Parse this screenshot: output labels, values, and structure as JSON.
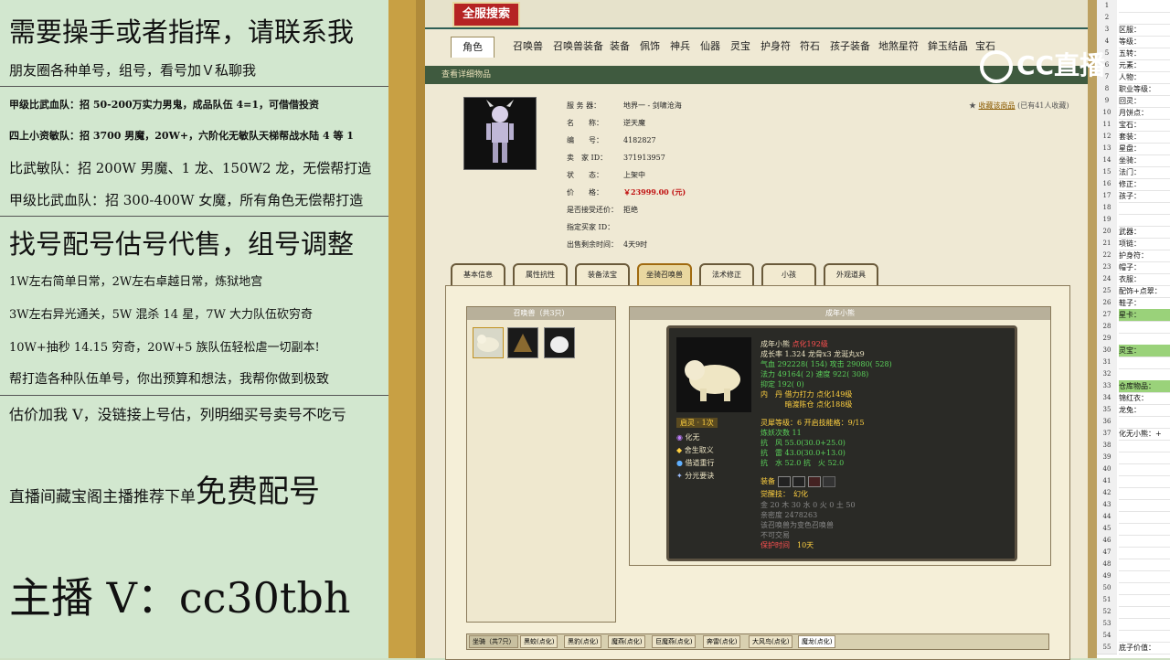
{
  "promo": {
    "line1": "需要操手或者指挥，请联系我",
    "line2": "朋友圈各种单号，组号，看号加Ｖ私聊我",
    "line3": "甲级比武血队：招 50-200万实力男鬼，成品队伍 4=1，可借借投资",
    "line4": "四上小资敏队：招 3700 男魔，20W+，六阶化无敏队天梯帮战水陆 4 等 1",
    "line5": "比武敏队：招 200W 男魔、1 龙、150W2 龙，无偿帮打造",
    "line6": "甲级比武血队：招 300-400W 女魔，所有角色无偿帮打造",
    "line7": "找号配号估号代售，组号调整",
    "line8": "1W左右简单日常，2W左右卓越日常，炼狱地宫",
    "line9": "3W左右异光通关，5W 混杀 14 星，7W 大力队伍砍穷奇",
    "line10": "10W+抽秒 14.15 穷奇，20W+5 族队伍轻松虐一切副本!",
    "line11": "帮打造各种队伍单号，你出预算和想法，我帮你做到极致",
    "line12": "估价加我 V，没链接上号估，列明细买号卖号不吃亏",
    "line13a": "直播间藏宝阁主播推荐下单",
    "line13b": "免费配号",
    "line14": "主播 V：cc30tbh"
  },
  "game": {
    "search_title": "全服搜索",
    "tabs": [
      "角色",
      "召唤兽",
      "召唤兽装备",
      "装备",
      "佩饰",
      "神兵",
      "仙器",
      "灵宝",
      "护身符",
      "符石",
      "孩子装备",
      "地煞星符",
      "鉾玉结晶",
      "宝石"
    ],
    "green_bar": "查看详细物品",
    "info": [
      {
        "k": "服 务 器：",
        "v": "地界一 - 剑啸沧海"
      },
      {
        "k": "名　　称：",
        "v": "逆天魔"
      },
      {
        "k": "编　　号：",
        "v": "4182827"
      },
      {
        "k": "卖　家 ID：",
        "v": "371913957"
      },
      {
        "k": "状　　态：",
        "v": "上架中"
      },
      {
        "k": "价　　格：",
        "v": "￥23999.00 (元)"
      },
      {
        "k": "是否接受还价：",
        "v": "拒绝"
      },
      {
        "k": "指定买家 ID：",
        "v": ""
      },
      {
        "k": "出售剩余时间：",
        "v": "4天9时"
      }
    ],
    "fav_link": "收藏该商品",
    "fav_count": "(已有41人收藏)",
    "subtabs": [
      "基本信息",
      "属性抗性",
      "装备法宝",
      "坐骑召唤兽",
      "法术修正",
      "小孩",
      "外观道具"
    ],
    "pet_list_title": "召唤兽（共3只）",
    "detail_title": "成年小熊",
    "card": {
      "name": "成年小熊",
      "level": "点化192级",
      "growth": "成长率 1.324  龙骨x3  龙涎丸x9",
      "hp": "气血 292228( 154)  攻击 29080( 528)",
      "mp": "法力 49164( 2)  速度 922( 308)",
      "def": "抑定 192( 0)",
      "inner1": "内　丹  借力打力 点化149级",
      "inner2": "　　　  暗渡陈仓 点化188级",
      "awaken": "启灵 · 1次",
      "skills": [
        "化无",
        "舍生取义",
        "借道重行",
        "分光要诀"
      ],
      "soul": "灵犀等级：6  开启技能格：9/15",
      "refine": "炼妖次数 11",
      "res1": "抗　风 55.0(30.0+25.0)",
      "res2": "抗　雷 43.0(30.0+13.0)",
      "res3": "抗　水 52.0  抗　火 52.0",
      "equip": "装备",
      "awaken_skill": "觉醒技：　幻化",
      "gold": "金 20 木 30 水 0 火 0 土 50",
      "exp": "亲密度 2478263",
      "note1": "该召唤兽为变色召唤兽",
      "note2": "不可交易",
      "protect": "保护时间",
      "protect_val": "10天"
    },
    "bottom_tabs": [
      "坐骑（共7只）",
      "黑蛟(点化)",
      "黑豹(点化)",
      "魔燕(点化)",
      "巨魔燕(点化)",
      "奔雷(点化)",
      "大风鸟(点化)",
      "魔龙(点化)"
    ]
  },
  "sheet": {
    "rows": [
      {
        "n": "1",
        "v": ""
      },
      {
        "n": "2",
        "v": ""
      },
      {
        "n": "3",
        "v": "区服："
      },
      {
        "n": "4",
        "v": "等级："
      },
      {
        "n": "5",
        "v": "五转："
      },
      {
        "n": "6",
        "v": "元素："
      },
      {
        "n": "7",
        "v": "人物："
      },
      {
        "n": "8",
        "v": "职业等级："
      },
      {
        "n": "9",
        "v": "回灵："
      },
      {
        "n": "10",
        "v": "月饼点："
      },
      {
        "n": "11",
        "v": "宝石："
      },
      {
        "n": "12",
        "v": "套装："
      },
      {
        "n": "13",
        "v": "星盘："
      },
      {
        "n": "14",
        "v": "坐骑："
      },
      {
        "n": "15",
        "v": "法门："
      },
      {
        "n": "16",
        "v": "修正："
      },
      {
        "n": "17",
        "v": "孩子："
      },
      {
        "n": "18",
        "v": ""
      },
      {
        "n": "19",
        "v": ""
      },
      {
        "n": "20",
        "v": "武器："
      },
      {
        "n": "21",
        "v": "项链："
      },
      {
        "n": "22",
        "v": "护身符："
      },
      {
        "n": "23",
        "v": "帽子："
      },
      {
        "n": "24",
        "v": "衣服："
      },
      {
        "n": "25",
        "v": "配饰+点翠："
      },
      {
        "n": "26",
        "v": "鞋子："
      },
      {
        "n": "27",
        "v": "星卡：",
        "hl": true
      },
      {
        "n": "28",
        "v": ""
      },
      {
        "n": "29",
        "v": ""
      },
      {
        "n": "30",
        "v": "灵宝：",
        "hl": true
      },
      {
        "n": "31",
        "v": ""
      },
      {
        "n": "32",
        "v": ""
      },
      {
        "n": "33",
        "v": "仓库物品：",
        "hl": true
      },
      {
        "n": "34",
        "v": "锦红衣："
      },
      {
        "n": "35",
        "v": "龙兔："
      },
      {
        "n": "36",
        "v": ""
      },
      {
        "n": "37",
        "v": "化无小熊：+"
      },
      {
        "n": "38",
        "v": ""
      },
      {
        "n": "39",
        "v": ""
      },
      {
        "n": "40",
        "v": ""
      },
      {
        "n": "41",
        "v": ""
      },
      {
        "n": "42",
        "v": ""
      },
      {
        "n": "43",
        "v": ""
      },
      {
        "n": "44",
        "v": ""
      },
      {
        "n": "45",
        "v": ""
      },
      {
        "n": "46",
        "v": ""
      },
      {
        "n": "47",
        "v": ""
      },
      {
        "n": "48",
        "v": ""
      },
      {
        "n": "49",
        "v": ""
      },
      {
        "n": "50",
        "v": ""
      },
      {
        "n": "51",
        "v": ""
      },
      {
        "n": "52",
        "v": ""
      },
      {
        "n": "53",
        "v": ""
      },
      {
        "n": "54",
        "v": ""
      },
      {
        "n": "55",
        "v": "底子价值："
      }
    ]
  },
  "logo_text": "CC直播"
}
